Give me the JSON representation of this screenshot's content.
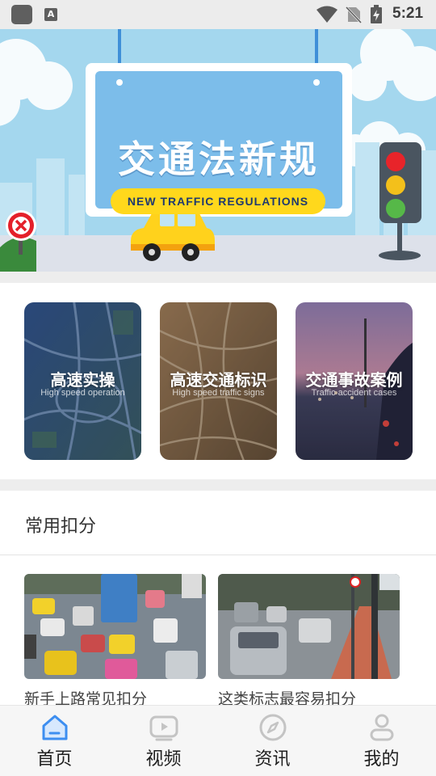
{
  "status_bar": {
    "app_badge_letter": "A",
    "time": "5:21"
  },
  "banner": {
    "title": "交通法新规",
    "subtitle": "NEW TRAFFIC REGULATIONS"
  },
  "categories": [
    {
      "title": "高速实操",
      "subtitle": "High speed operation"
    },
    {
      "title": "高速交通标识",
      "subtitle": "High speed traffic signs"
    },
    {
      "title": "交通事故案例",
      "subtitle": "Traffic accident cases"
    }
  ],
  "section": {
    "title": "常用扣分"
  },
  "articles": [
    {
      "caption": "新手上路常见扣分"
    },
    {
      "caption": "这类标志最容易扣分"
    }
  ],
  "nav": [
    {
      "label": "首页",
      "icon": "home-icon",
      "active": true
    },
    {
      "label": "视频",
      "icon": "video-icon",
      "active": false
    },
    {
      "label": "资讯",
      "icon": "compass-icon",
      "active": false
    },
    {
      "label": "我的",
      "icon": "profile-icon",
      "active": false
    }
  ],
  "colors": {
    "accent": "#3d8ef0",
    "nav_inactive": "#c4c4c4",
    "banner_sky": "#9dd3ec",
    "banner_board": "#7cbdea",
    "banner_badge": "#ffd81c"
  }
}
